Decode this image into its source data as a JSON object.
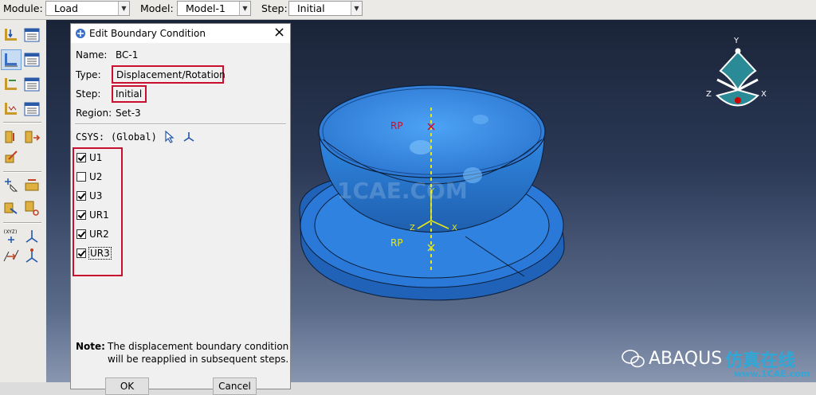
{
  "toolbar": {
    "module_label": "Module:",
    "module_value": "Load",
    "model_label": "Model:",
    "model_value": "Model-1",
    "step_label": "Step:",
    "step_value": "Initial"
  },
  "dialog": {
    "title": "Edit Boundary Condition",
    "close": "×",
    "name_label": "Name:",
    "name_value": "BC-1",
    "type_label": "Type:",
    "type_value": "Displacement/Rotation",
    "step_label": "Step:",
    "step_value": "Initial",
    "region_label": "Region:",
    "region_value": "Set-3",
    "csys_label": "CSYS:",
    "csys_value": "(Global)",
    "dofs": [
      {
        "label": "U1",
        "checked": true
      },
      {
        "label": "U2",
        "checked": false
      },
      {
        "label": "U3",
        "checked": true
      },
      {
        "label": "UR1",
        "checked": true
      },
      {
        "label": "UR2",
        "checked": true
      },
      {
        "label": "UR3",
        "checked": true
      }
    ],
    "note_label": "Note:",
    "note_line1": "The displacement boundary condition",
    "note_line2": "will be reapplied in subsequent steps.",
    "ok_label": "OK",
    "cancel_label": "Cancel"
  },
  "viewport": {
    "rp_top": "RP",
    "rp_bottom": "RP",
    "axis_x": "X",
    "axis_y": "Y",
    "axis_z": "Z",
    "triad_x": "X",
    "triad_y": "Y",
    "triad_z": "Z",
    "watermark_center": "1CAE.COM",
    "watermark_brand": "ABAQUS",
    "watermark_cn": "仿真在线",
    "watermark_url": "www.1CAE.com"
  },
  "colors": {
    "highlight": "#c8102e",
    "part_blue": "#2f7fd6",
    "marker_yellow": "#e6e617"
  }
}
